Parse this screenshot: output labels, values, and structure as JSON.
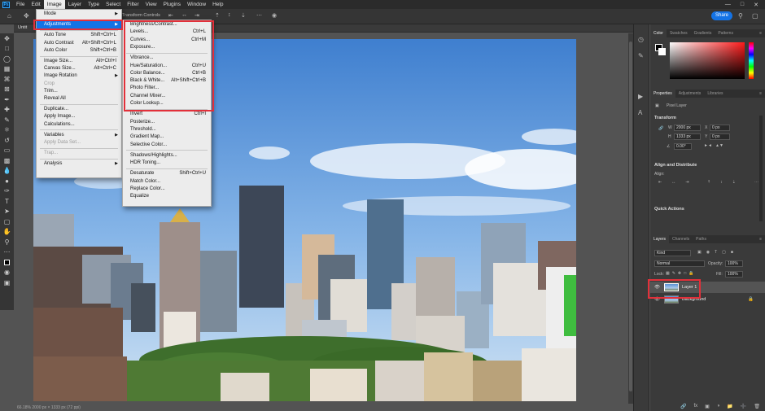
{
  "app": {
    "logo": "Ps"
  },
  "menubar": {
    "items": [
      "File",
      "Edit",
      "Image",
      "Layer",
      "Type",
      "Select",
      "Filter",
      "View",
      "Plugins",
      "Window",
      "Help"
    ],
    "active": "Image"
  },
  "options_bar": {
    "transform_controls": "Transform Controls",
    "share_label": "Share"
  },
  "doc_tab": {
    "title": "Untit"
  },
  "status_text": "66.18%     2000 px × 1333 px (72 ppi)",
  "image_menu": {
    "items": [
      {
        "label": "Mode",
        "shortcut": "",
        "submenu": true,
        "disabled": false
      },
      {
        "sep": true
      },
      {
        "label": "Adjustments",
        "shortcut": "",
        "submenu": true,
        "disabled": false,
        "highlighted": true
      },
      {
        "sep": true
      },
      {
        "label": "Auto Tone",
        "shortcut": "Shift+Ctrl+L",
        "disabled": false
      },
      {
        "label": "Auto Contrast",
        "shortcut": "Alt+Shift+Ctrl+L",
        "disabled": false
      },
      {
        "label": "Auto Color",
        "shortcut": "Shift+Ctrl+B",
        "disabled": false
      },
      {
        "sep": true
      },
      {
        "label": "Image Size...",
        "shortcut": "Alt+Ctrl+I",
        "disabled": false
      },
      {
        "label": "Canvas Size...",
        "shortcut": "Alt+Ctrl+C",
        "disabled": false
      },
      {
        "label": "Image Rotation",
        "shortcut": "",
        "submenu": true,
        "disabled": false
      },
      {
        "label": "Crop",
        "shortcut": "",
        "disabled": true
      },
      {
        "label": "Trim...",
        "shortcut": "",
        "disabled": false
      },
      {
        "label": "Reveal All",
        "shortcut": "",
        "disabled": false
      },
      {
        "sep": true
      },
      {
        "label": "Duplicate...",
        "shortcut": "",
        "disabled": false
      },
      {
        "label": "Apply Image...",
        "shortcut": "",
        "disabled": false
      },
      {
        "label": "Calculations...",
        "shortcut": "",
        "disabled": false
      },
      {
        "sep": true
      },
      {
        "label": "Variables",
        "shortcut": "",
        "submenu": true,
        "disabled": false
      },
      {
        "label": "Apply Data Set...",
        "shortcut": "",
        "disabled": true
      },
      {
        "sep": true
      },
      {
        "label": "Trap...",
        "shortcut": "",
        "disabled": true
      },
      {
        "sep": true
      },
      {
        "label": "Analysis",
        "shortcut": "",
        "submenu": true,
        "disabled": false
      }
    ]
  },
  "adjustments_menu": {
    "items": [
      {
        "label": "Brightness/Contrast...",
        "shortcut": ""
      },
      {
        "label": "Levels...",
        "shortcut": "Ctrl+L"
      },
      {
        "label": "Curves...",
        "shortcut": "Ctrl+M"
      },
      {
        "label": "Exposure...",
        "shortcut": ""
      },
      {
        "sep": true
      },
      {
        "label": "Vibrance...",
        "shortcut": ""
      },
      {
        "label": "Hue/Saturation...",
        "shortcut": "Ctrl+U"
      },
      {
        "label": "Color Balance...",
        "shortcut": "Ctrl+B"
      },
      {
        "label": "Black & White...",
        "shortcut": "Alt+Shift+Ctrl+B"
      },
      {
        "label": "Photo Filter...",
        "shortcut": ""
      },
      {
        "label": "Channel Mixer...",
        "shortcut": ""
      },
      {
        "label": "Color Lookup...",
        "shortcut": ""
      },
      {
        "sep": true
      },
      {
        "label": "Invert",
        "shortcut": "Ctrl+I"
      },
      {
        "label": "Posterize...",
        "shortcut": ""
      },
      {
        "label": "Threshold...",
        "shortcut": ""
      },
      {
        "label": "Gradient Map...",
        "shortcut": ""
      },
      {
        "label": "Selective Color...",
        "shortcut": ""
      },
      {
        "sep": true
      },
      {
        "label": "Shadows/Highlights...",
        "shortcut": ""
      },
      {
        "label": "HDR Toning...",
        "shortcut": ""
      },
      {
        "sep": true
      },
      {
        "label": "Desaturate",
        "shortcut": "Shift+Ctrl+U"
      },
      {
        "label": "Match Color...",
        "shortcut": ""
      },
      {
        "label": "Replace Color...",
        "shortcut": ""
      },
      {
        "label": "Equalize",
        "shortcut": ""
      }
    ]
  },
  "color_panel": {
    "tabs": [
      "Color",
      "Swatches",
      "Gradients",
      "Patterns"
    ],
    "active": "Color"
  },
  "properties_panel": {
    "tabs": [
      "Properties",
      "Adjustments",
      "Libraries"
    ],
    "active": "Properties",
    "layer_type": "Pixel Layer",
    "transform_heading": "Transform",
    "w": "2000 px",
    "h": "1333 px",
    "x": "0 px",
    "y": "0 px",
    "angle": "0.00°",
    "w_label": "W",
    "h_label": "H",
    "x_label": "X",
    "y_label": "Y",
    "align_heading": "Align and Distribute",
    "align_label": "Align:",
    "quick_heading": "Quick Actions"
  },
  "layers_panel": {
    "tabs": [
      "Layers",
      "Channels",
      "Paths"
    ],
    "active": "Layers",
    "kind_label": "Kind",
    "blend_mode": "Normal",
    "opacity_label": "Opacity:",
    "opacity": "100%",
    "lock_label": "Lock:",
    "fill_label": "Fill:",
    "fill": "100%",
    "layers": [
      {
        "name": "Layer 1",
        "selected": true
      },
      {
        "name": "Background",
        "selected": false,
        "locked": true
      }
    ]
  },
  "colors": {
    "accent": "#1473e6",
    "highlight_box": "#e2303a",
    "menu_bg": "#ececec",
    "app_bg": "#535353"
  }
}
